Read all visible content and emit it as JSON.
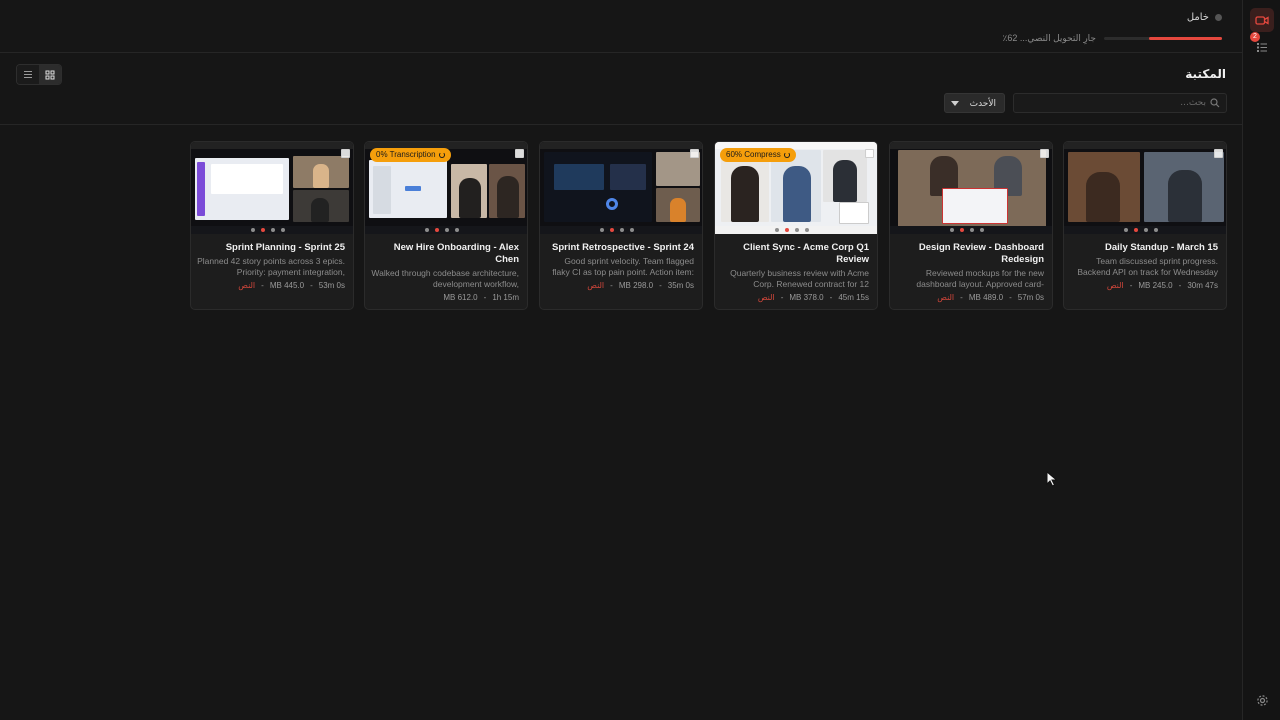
{
  "status": {
    "label": "خامل"
  },
  "progress": {
    "label": "جارِ التحويل النصي... 62٪",
    "fraction": 0.62
  },
  "library": {
    "title": "المكتبة"
  },
  "search": {
    "placeholder": "بحث..."
  },
  "sort": {
    "label": "الأحدث"
  },
  "rail": {
    "notification_count": "2"
  },
  "colors": {
    "accent": "#e5483e",
    "badge": "#f59e0b"
  },
  "cards": [
    {
      "title": "Daily Standup - March 15",
      "description": "Team discussed sprint progress. Backend API on track for Wednesday",
      "tag": "النص",
      "size": "245.0 MB",
      "duration": "30m 47s",
      "badge": "",
      "theme": "light"
    },
    {
      "title": "Design Review - Dashboard Redesign",
      "description": "Reviewed mockups for the new dashboard layout. Approved card-",
      "tag": "النص",
      "size": "489.0 MB",
      "duration": "57m 0s",
      "badge": "",
      "theme": "light"
    },
    {
      "title": "Client Sync - Acme Corp Q1 Review",
      "description": "Quarterly business review with Acme Corp. Renewed contract for 12",
      "tag": "النص",
      "size": "378.0 MB",
      "duration": "45m 15s",
      "badge": "60% Compress",
      "theme": "light"
    },
    {
      "title": "Sprint Retrospective - Sprint 24",
      "description": "Good sprint velocity. Team flagged flaky CI as top pain point. Action item:",
      "tag": "النص",
      "size": "298.0 MB",
      "duration": "35m 0s",
      "badge": "",
      "theme": "dark"
    },
    {
      "title": "New Hire Onboarding - Alex Chen",
      "description": "Walked through codebase architecture, development workflow,",
      "tag": "",
      "size": "612.0 MB",
      "duration": "1h 15m",
      "badge": "0% Transcription",
      "theme": "light"
    },
    {
      "title": "Sprint Planning - Sprint 25",
      "description": "Planned 42 story points across 3 epics. Priority: payment integration,",
      "tag": "النص",
      "size": "445.0 MB",
      "duration": "53m 0s",
      "badge": "",
      "theme": "light"
    }
  ]
}
